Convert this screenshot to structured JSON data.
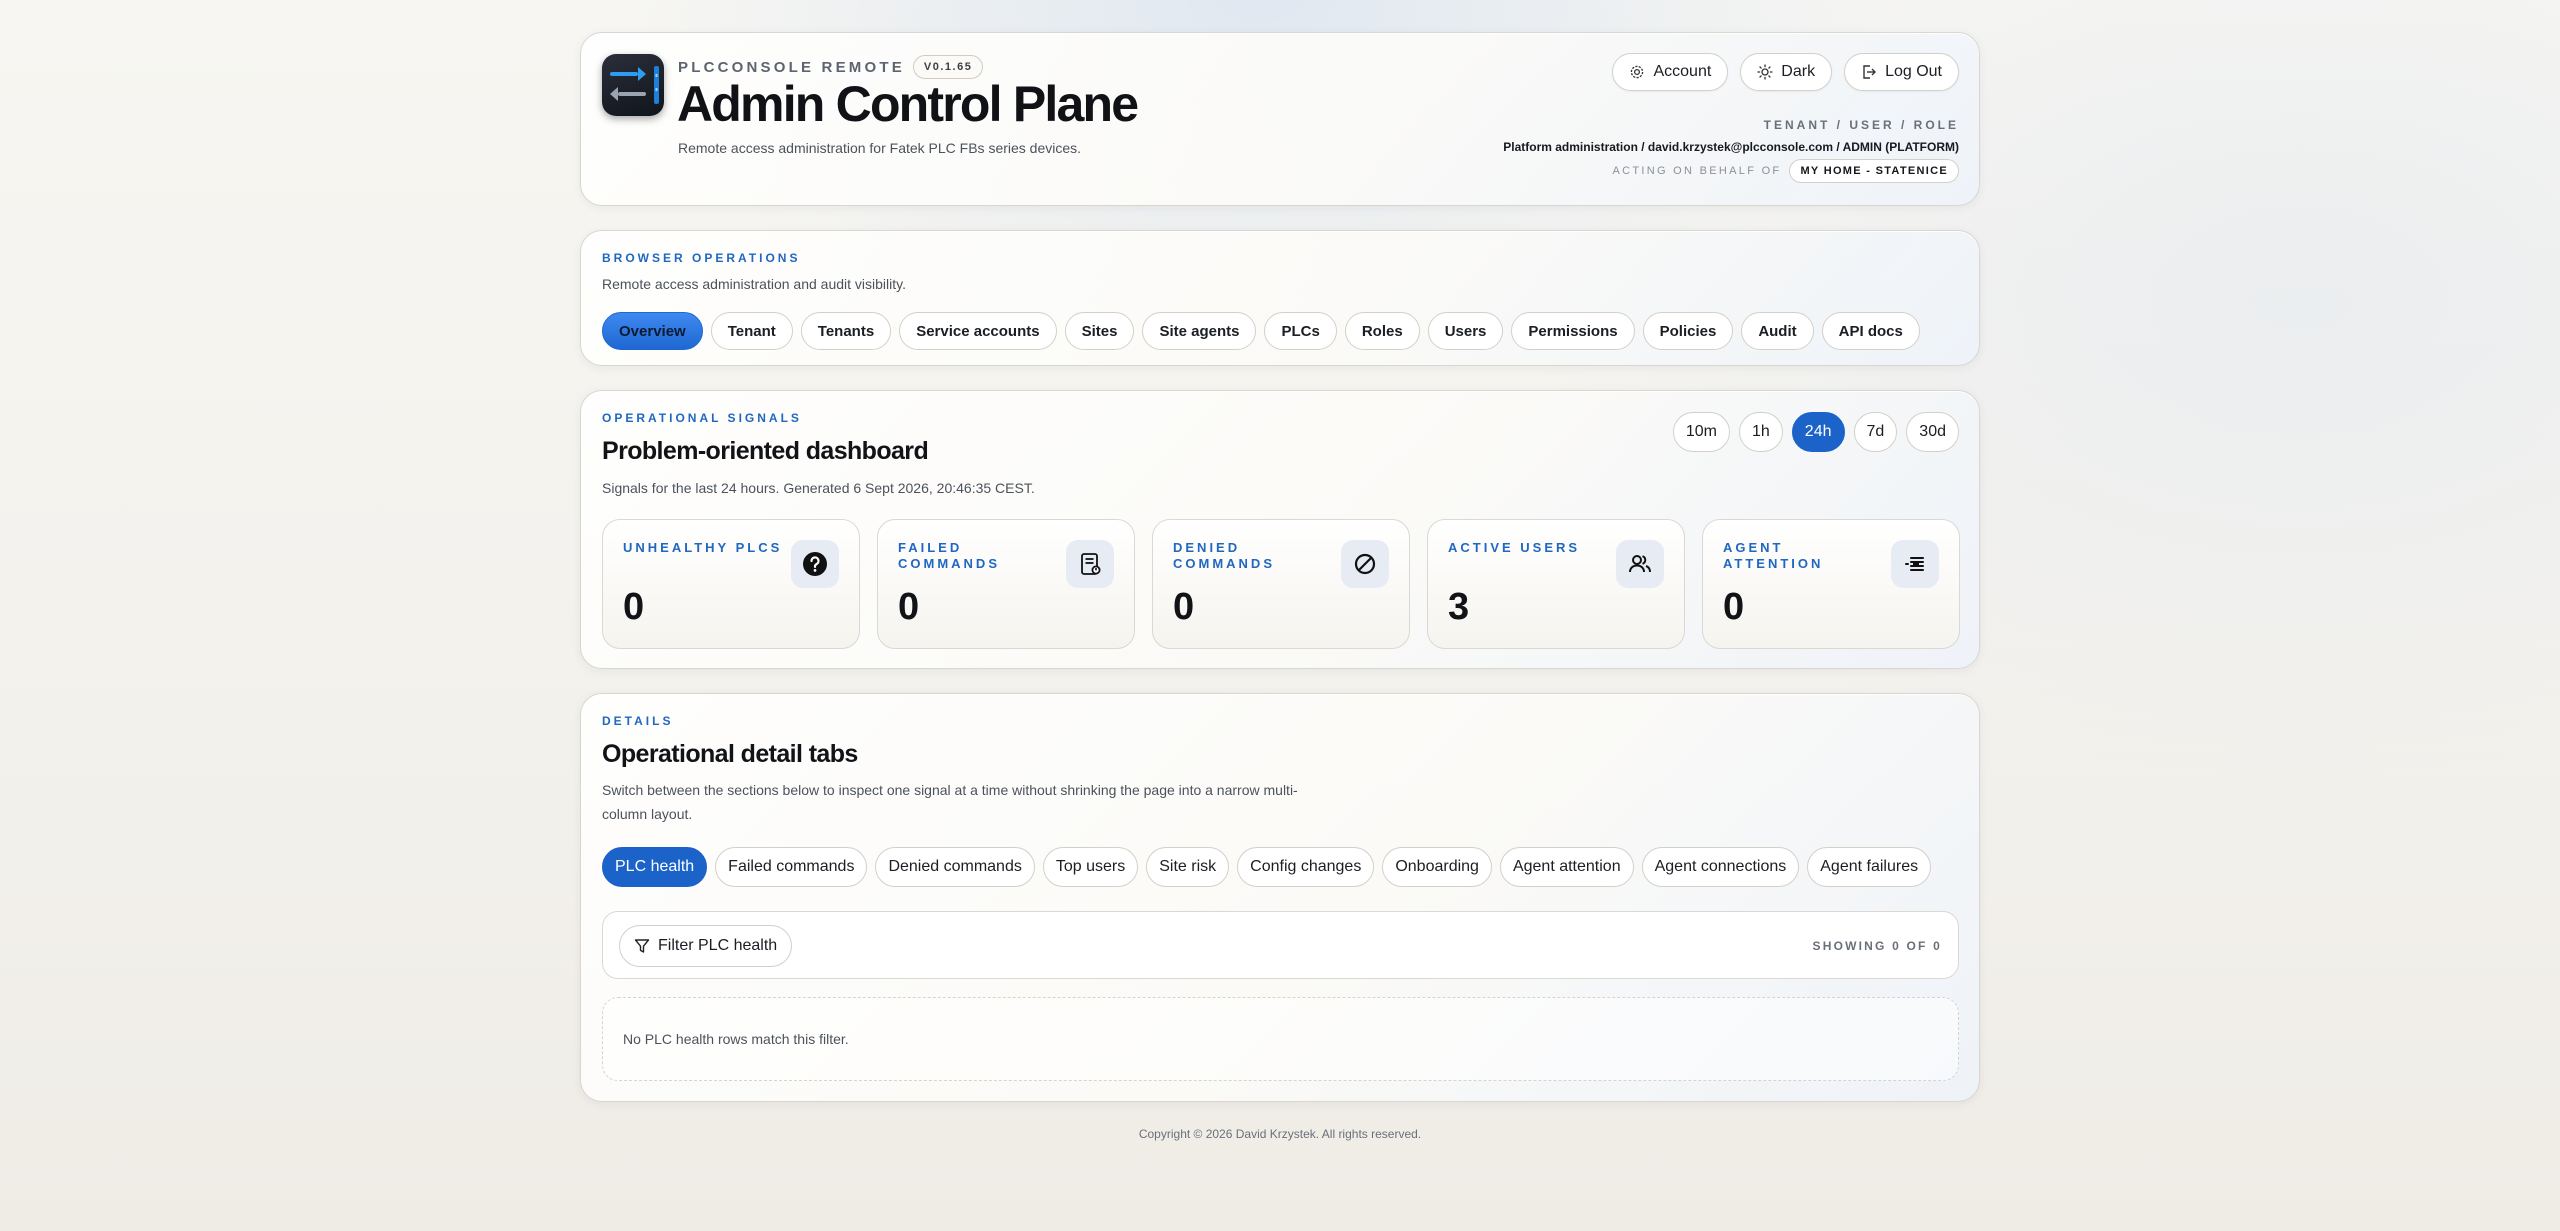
{
  "header": {
    "brand": "PLCCONSOLE REMOTE",
    "version": "V0.1.65",
    "title": "Admin Control Plane",
    "subtitle": "Remote access administration for Fatek PLC FBs series devices.",
    "buttons": {
      "account": "Account",
      "dark": "Dark",
      "logout": "Log Out"
    },
    "meta_label": "TENANT / USER / ROLE",
    "meta_value": "Platform administration / david.krzystek@plcconsole.com / ADMIN (PLATFORM)",
    "acting_label": "ACTING ON BEHALF OF",
    "acting_value": "MY HOME - STATENICE"
  },
  "browser_ops": {
    "eyebrow": "BROWSER OPERATIONS",
    "description": "Remote access administration and audit visibility.",
    "nav": [
      "Overview",
      "Tenant",
      "Tenants",
      "Service accounts",
      "Sites",
      "Site agents",
      "PLCs",
      "Roles",
      "Users",
      "Permissions",
      "Policies",
      "Audit",
      "API docs"
    ],
    "active_nav": "Overview"
  },
  "signals": {
    "eyebrow": "OPERATIONAL SIGNALS",
    "title": "Problem-oriented dashboard",
    "description": "Signals for the last 24 hours. Generated 6 Sept 2026, 20:46:35 CEST.",
    "ranges": [
      "10m",
      "1h",
      "24h",
      "7d",
      "30d"
    ],
    "active_range": "24h",
    "cards": [
      {
        "label": "UNHEALTHY PLCS",
        "value": "0",
        "icon": "question-circle-icon"
      },
      {
        "label": "FAILED COMMANDS",
        "value": "0",
        "icon": "report-icon"
      },
      {
        "label": "DENIED COMMANDS",
        "value": "0",
        "icon": "blocked-icon"
      },
      {
        "label": "ACTIVE USERS",
        "value": "3",
        "icon": "users-icon"
      },
      {
        "label": "AGENT ATTENTION",
        "value": "0",
        "icon": "list-alert-icon"
      }
    ]
  },
  "details": {
    "eyebrow": "DETAILS",
    "title": "Operational detail tabs",
    "description": "Switch between the sections below to inspect one signal at a time without shrinking the page into a narrow multi-column layout.",
    "tabs": [
      "PLC health",
      "Failed commands",
      "Denied commands",
      "Top users",
      "Site risk",
      "Config changes",
      "Onboarding",
      "Agent attention",
      "Agent connections",
      "Agent failures"
    ],
    "active_tab": "PLC health",
    "filter_label": "Filter PLC health",
    "showing": "SHOWING 0 OF 0",
    "empty_message": "No PLC health rows match this filter."
  },
  "footer": "Copyright © 2026 David Krzystek. All rights reserved.",
  "colors": {
    "accent": "#1b62c9",
    "eyebrow": "#1f67c1"
  }
}
